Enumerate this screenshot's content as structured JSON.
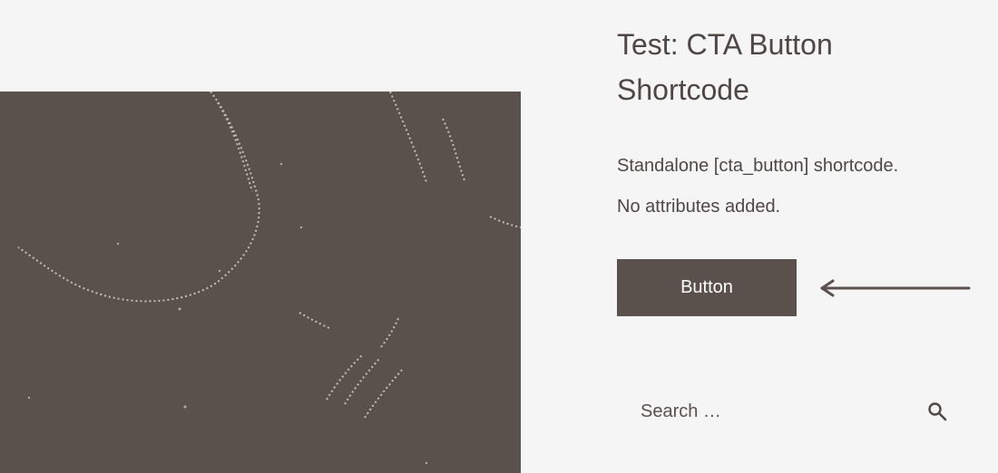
{
  "post": {
    "title": "Test: CTA Button Shortcode",
    "description_line_1": "Standalone [cta_button] shortcode.",
    "description_line_2": "No attributes added.",
    "cta_button_label": "Button"
  },
  "search": {
    "placeholder": "Search …"
  },
  "colors": {
    "background": "#f5f5f5",
    "brand": "#5a504c",
    "text": "#4e4746",
    "button_text": "#ffffff"
  },
  "icons": {
    "arrow": "arrow-left-icon",
    "search": "search-icon"
  }
}
